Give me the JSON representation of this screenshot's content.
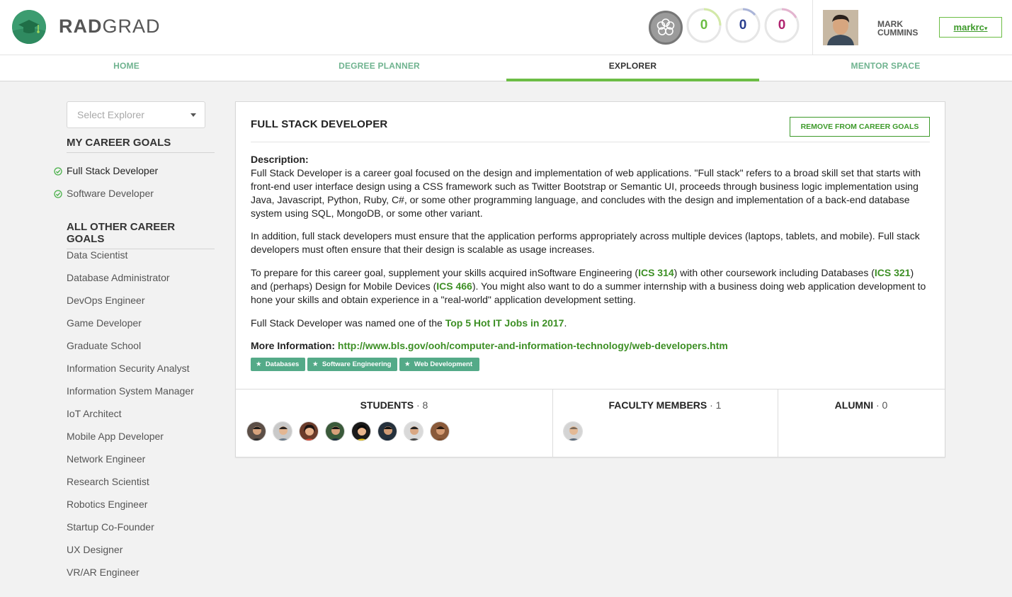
{
  "brand": {
    "name_bold": "RAD",
    "name_rest": "GRAD"
  },
  "header": {
    "ice": [
      {
        "value": "0",
        "color": "#6cbd45"
      },
      {
        "value": "0",
        "color": "#2a3f8f"
      },
      {
        "value": "0",
        "color": "#b0236f"
      }
    ],
    "user_first": "MARK",
    "user_last": "CUMMINS",
    "user_button": "markrc"
  },
  "nav": {
    "tabs": [
      "HOME",
      "DEGREE PLANNER",
      "EXPLORER",
      "MENTOR SPACE"
    ],
    "active": "EXPLORER"
  },
  "sidebar": {
    "select_placeholder": "Select Explorer",
    "my_goals_header": "MY CAREER GOALS",
    "my_goals": [
      "Full Stack Developer",
      "Software Developer"
    ],
    "other_goals_header": "ALL OTHER CAREER GOALS",
    "other_goals": [
      "Data Scientist",
      "Database Administrator",
      "DevOps Engineer",
      "Game Developer",
      "Graduate School",
      "Information Security Analyst",
      "Information System Manager",
      "IoT Architect",
      "Mobile App Developer",
      "Network Engineer",
      "Research Scientist",
      "Robotics Engineer",
      "Startup Co-Founder",
      "UX Designer",
      "VR/AR Engineer"
    ]
  },
  "main": {
    "title": "FULL STACK DEVELOPER",
    "remove_button": "REMOVE FROM CAREER GOALS",
    "description_label": "Description:",
    "p1": "Full Stack Developer is a career goal focused on the design and implementation of web applications. \"Full stack\" refers to a broad skill set that starts with front-end user interface design using a CSS framework such as Twitter Bootstrap or Semantic UI, proceeds through business logic implementation using Java, Javascript, Python, Ruby, C#, or some other programming language, and concludes with the design and implementation of a back-end database system using SQL, MongoDB, or some other variant.",
    "p2": "In addition, full stack developers must ensure that the application performs appropriately across multiple devices (laptops, tablets, and mobile). Full stack developers must often ensure that their design is scalable as usage increases.",
    "p3": {
      "t1": "To prepare for this career goal, supplement your skills acquired inSoftware Engineering (",
      "l1": "ICS 314",
      "t2": ") with other coursework including Databases (",
      "l2": "ICS 321",
      "t3": ") and (perhaps) Design for Mobile Devices (",
      "l3": "ICS 466",
      "t4": "). You might also want to do a summer internship with a business doing web application development to hone your skills and obtain experience in a \"real-world\" application development setting."
    },
    "p4": {
      "t1": "Full Stack Developer was named one of the ",
      "link": "Top 5 Hot IT Jobs in 2017",
      "t2": "."
    },
    "more_info_label": "More Information:",
    "more_info_link": "http://www.bls.gov/ooh/computer-and-information-technology/web-developers.htm",
    "tags": [
      "Databases",
      "Software Engineering",
      "Web Development"
    ],
    "students_label": "STUDENTS",
    "students_count": "· 8",
    "faculty_label": "FACULTY MEMBERS",
    "faculty_count": "· 1",
    "alumni_label": "ALUMNI",
    "alumni_count": "· 0"
  }
}
